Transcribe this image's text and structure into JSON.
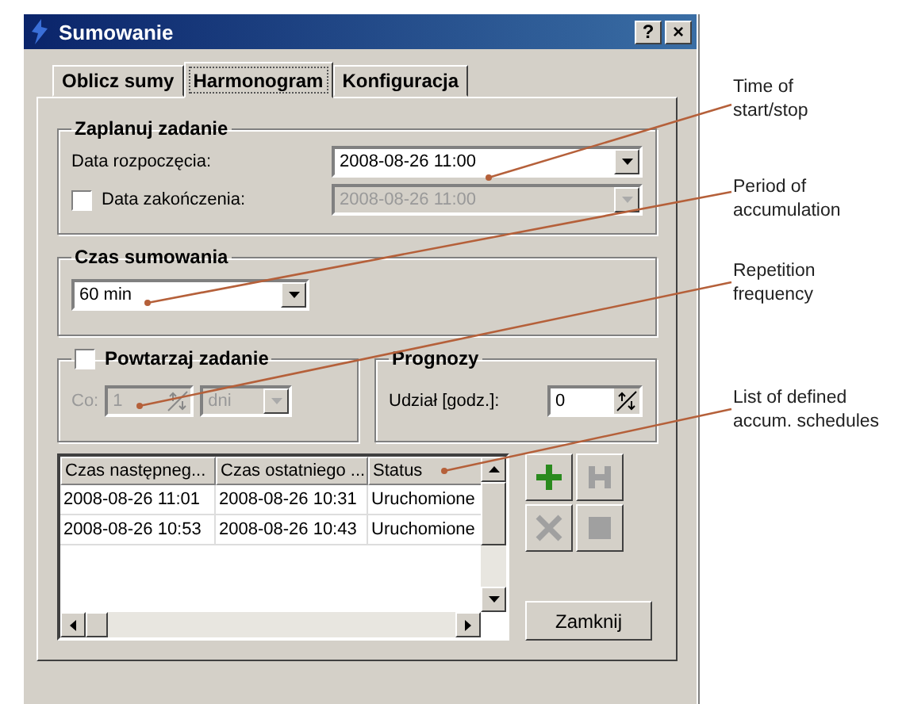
{
  "window": {
    "title": "Sumowanie",
    "help": "?",
    "close": "×"
  },
  "tabs": [
    {
      "label": "Oblicz sumy",
      "selected": false
    },
    {
      "label": "Harmonogram",
      "selected": true
    },
    {
      "label": "Konfiguracja",
      "selected": false
    }
  ],
  "schedule": {
    "title": "Zaplanuj zadanie",
    "start_label": "Data rozpoczęcia:",
    "start_value": "2008-08-26 11:00",
    "end_label": "Data zakończenia:",
    "end_checked": false,
    "end_value": "2008-08-26 11:00"
  },
  "period": {
    "title": "Czas sumowania",
    "value": "60 min"
  },
  "repeat": {
    "title": "Powtarzaj zadanie",
    "checked": false,
    "every_label": "Co:",
    "every_value": "1",
    "unit_value": "dni"
  },
  "forecast": {
    "title": "Prognozy",
    "share_label": "Udział [godz.]:",
    "share_value": "0"
  },
  "list": {
    "columns": [
      "Czas następneg...",
      "Czas ostatniego ...",
      "Status"
    ],
    "rows": [
      {
        "cells": [
          "2008-08-26 11:01",
          "2008-08-26 10:31",
          "Uruchomione"
        ],
        "selected": false
      },
      {
        "cells": [
          "2008-08-26 10:53",
          "2008-08-26 10:43",
          "Uruchomione"
        ],
        "selected": false
      }
    ]
  },
  "actions": [
    {
      "kind": "add",
      "disabled": false
    },
    {
      "kind": "save",
      "disabled": true
    },
    {
      "kind": "delete",
      "disabled": true
    },
    {
      "kind": "stop",
      "disabled": true
    }
  ],
  "close_button": "Zamknij",
  "annotations": [
    {
      "lines": [
        "Time of",
        "start/stop"
      ]
    },
    {
      "lines": [
        "Period of",
        "accumulation"
      ]
    },
    {
      "lines": [
        "Repetition",
        "frequency"
      ]
    },
    {
      "lines": [
        "List of defined",
        "accum. schedules"
      ]
    }
  ]
}
